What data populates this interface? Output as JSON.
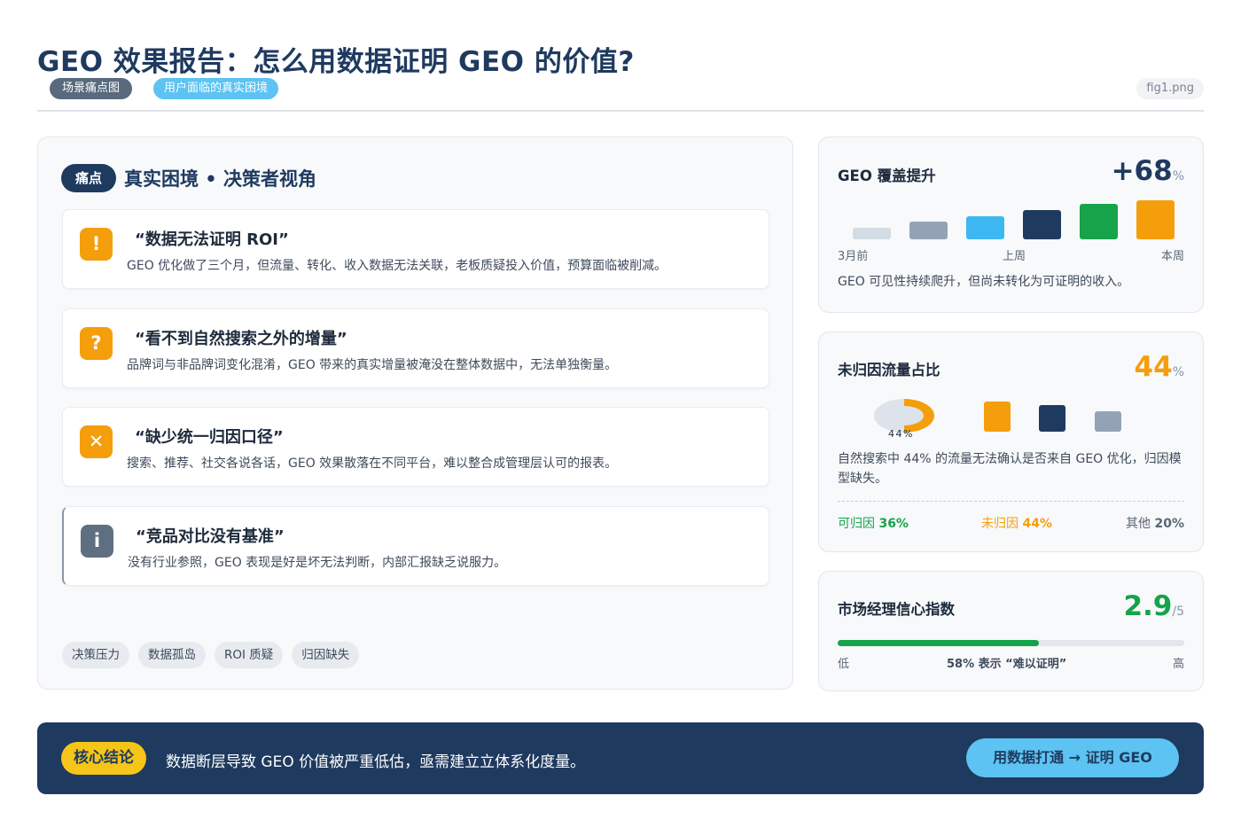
{
  "header": {
    "title": "GEO 效果报告：怎么用数据证明 GEO 的价值?",
    "tag_scene": "场景痛点图",
    "tag_user": "用户面临的真实困境",
    "filename": "fig1.png"
  },
  "pain_section": {
    "badge": "痛点",
    "heading": "真实困境 • 决策者视角",
    "cards": [
      {
        "icon": "!",
        "icon_name": "exclamation-icon",
        "icon_color": "#f59e0b",
        "title": "“数据无法证明 ROI”",
        "desc": "GEO 优化做了三个月，但流量、转化、收入数据无法关联，老板质疑投入价值，预算面临被削减。"
      },
      {
        "icon": "?",
        "icon_name": "question-icon",
        "icon_color": "#f59e0b",
        "title": "“看不到自然搜索之外的增量”",
        "desc": "品牌词与非品牌词变化混淆，GEO 带来的真实增量被淹没在整体数据中，无法单独衡量。"
      },
      {
        "icon": "✕",
        "icon_name": "close-icon",
        "icon_color": "#f59e0b",
        "title": "“缺少统一归因口径”",
        "desc": "搜索、推荐、社交各说各话，GEO 效果散落在不同平台，难以整合成管理层认可的报表。"
      },
      {
        "icon": "i",
        "icon_name": "info-icon",
        "icon_color": "#5f6f82",
        "title": "“竞品对比没有基准”",
        "desc": "没有行业参照，GEO 表现是好是坏无法判断，内部汇报缺乏说服力。"
      }
    ],
    "chips": [
      "决策压力",
      "数据孤岛",
      "ROI 质疑",
      "归因缺失"
    ]
  },
  "coverage": {
    "title": "GEO 覆盖提升",
    "value": "+68",
    "unit": "%",
    "value_color": "#1f3a5f",
    "label_start": "3月前",
    "label_mid": "上周",
    "label_end": "本周",
    "bar_colors": [
      "#d3dbe4",
      "#93a3b5",
      "#3db8f2",
      "#1f3a5f",
      "#16a34a",
      "#f59e0b"
    ],
    "bar_levels": [
      0.3,
      0.46,
      0.58,
      0.74,
      0.9,
      1.0
    ],
    "desc": "GEO 可见性持续爬升，但尚未转化为可证明的收入。"
  },
  "unattributed": {
    "title": "未归因流量占比",
    "value": "44",
    "unit": "%",
    "value_color": "#f59e0b",
    "donut_label": "44%",
    "square_colors": [
      "#f59e0b",
      "#1f3a5f",
      "#93a3b5"
    ],
    "desc": "自然搜索中 44% 的流量无法确认是否来自 GEO 优化，归因模型缺失。",
    "attributed_label": "可归因",
    "attributed_value": "36%",
    "unattr_label": "未归因",
    "unattr_value": "44%",
    "other_label": "其他",
    "other_value": "20%"
  },
  "confidence": {
    "title": "市场经理信心指数",
    "value": "2.9",
    "unit": "/5",
    "value_color": "#16a34a",
    "progress": 0.58,
    "low": "低",
    "note": "58% 表示 “难以证明”",
    "high": "高"
  },
  "bottom": {
    "badge": "核心结论",
    "text": "数据断层导致 GEO 价值被严重低估，亟需建立立体系化度量。",
    "cta": "用数据打通 → 证明 GEO"
  }
}
